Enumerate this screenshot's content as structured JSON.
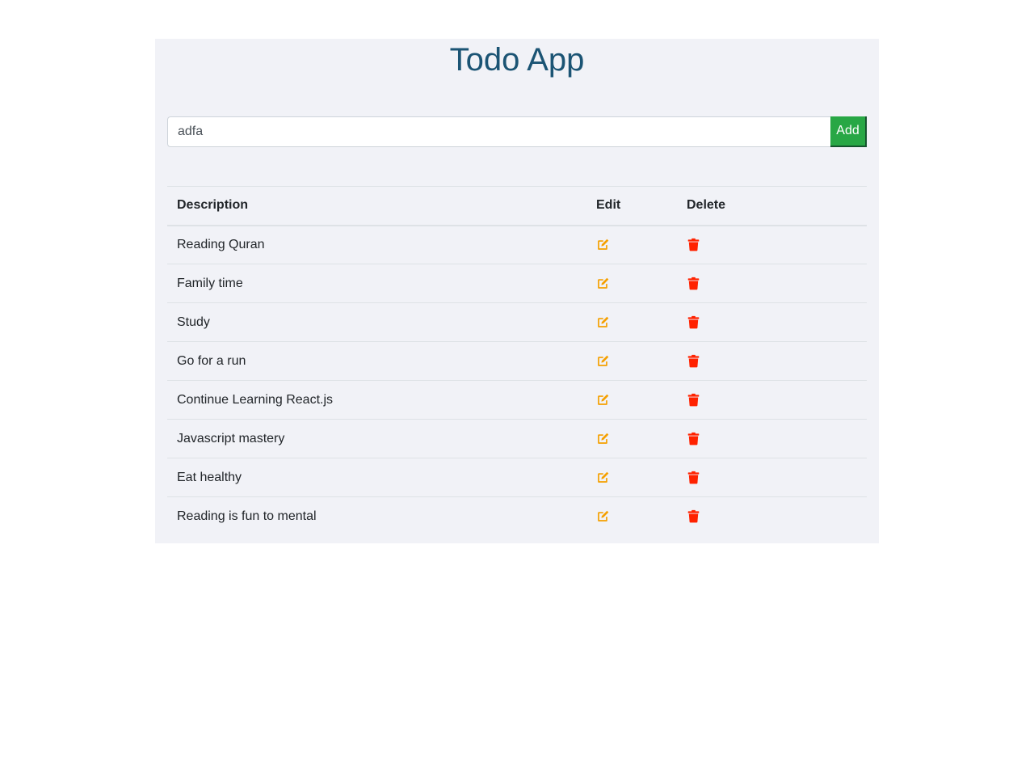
{
  "header": {
    "title": "Todo App"
  },
  "add_form": {
    "input_value": "adfa",
    "button_label": "Add"
  },
  "table": {
    "headers": {
      "description": "Description",
      "edit": "Edit",
      "delete": "Delete"
    },
    "rows": [
      {
        "description": "Reading Quran",
        "edit_icon": "edit-icon",
        "delete_icon": "trash-icon"
      },
      {
        "description": "Family time",
        "edit_icon": "edit-icon",
        "delete_icon": "trash-icon"
      },
      {
        "description": "Study",
        "edit_icon": "edit-icon",
        "delete_icon": "trash-icon"
      },
      {
        "description": "Go for a run",
        "edit_icon": "edit-icon",
        "delete_icon": "trash-icon"
      },
      {
        "description": "Continue Learning React.js",
        "edit_icon": "edit-icon",
        "delete_icon": "trash-icon"
      },
      {
        "description": "Javascript mastery",
        "edit_icon": "edit-icon",
        "delete_icon": "trash-icon"
      },
      {
        "description": "Eat healthy",
        "edit_icon": "edit-icon",
        "delete_icon": "trash-icon"
      },
      {
        "description": "Reading is fun to mental",
        "edit_icon": "edit-icon",
        "delete_icon": "trash-icon"
      }
    ]
  },
  "colors": {
    "title": "#1b5474",
    "panel_background": "#f1f2f7",
    "add_button": "#28a745",
    "edit_icon": "#f5a000",
    "delete_icon": "#ff2200"
  }
}
